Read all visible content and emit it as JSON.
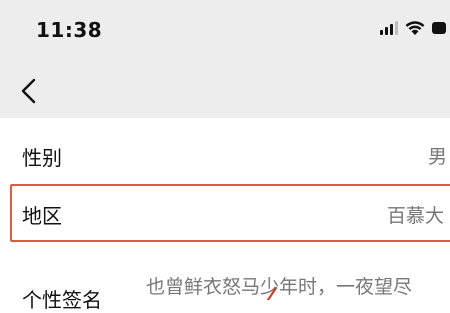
{
  "status_bar": {
    "time": "11:38",
    "icons": [
      "cellular-signal-icon",
      "wifi-icon",
      "battery-icon"
    ]
  },
  "nav_bar": {
    "back_icon": "chevron-left-icon"
  },
  "profile_rows": {
    "gender": {
      "label": "性别",
      "value": "男"
    },
    "region": {
      "label": "地区",
      "value": "百慕大"
    },
    "signature": {
      "label": "个性签名",
      "value": "也曾鲜衣怒马少年时，一夜望尽"
    }
  },
  "colors": {
    "background": "#ededed",
    "highlight_border": "#d4603f",
    "value_text": "#777777"
  }
}
